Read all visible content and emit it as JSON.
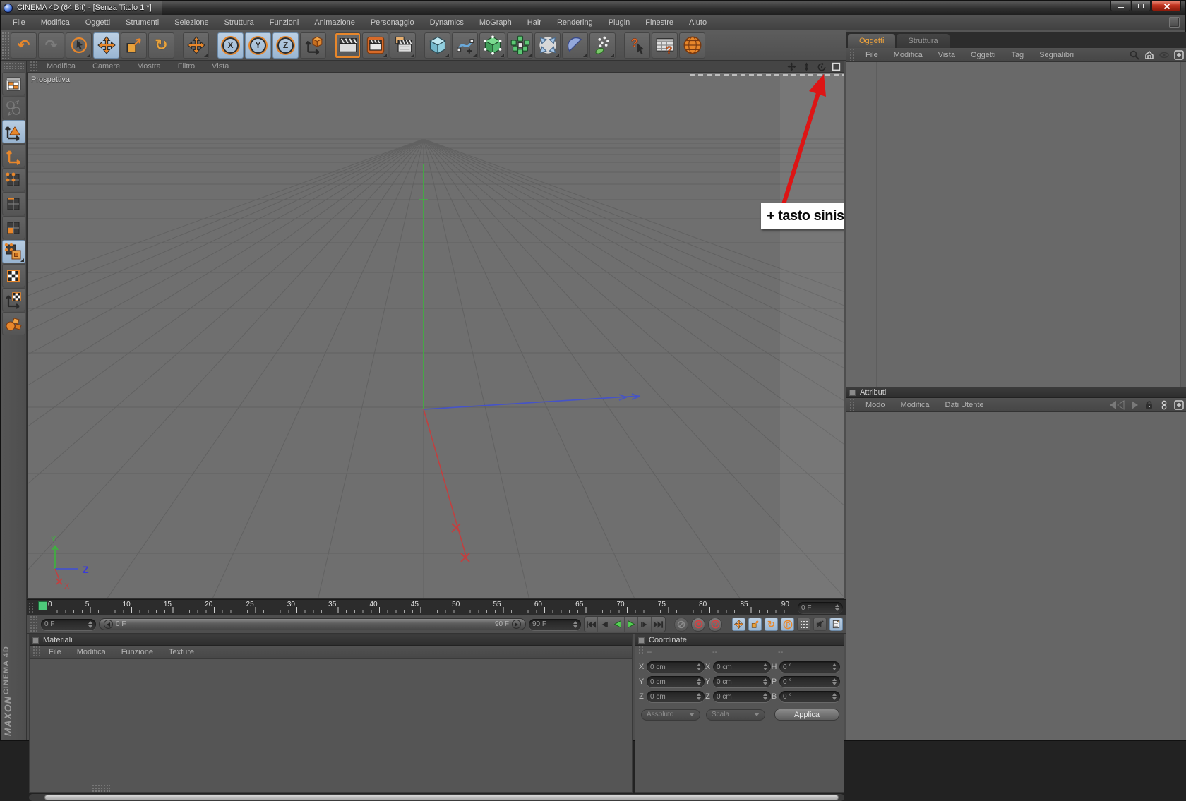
{
  "window": {
    "title": "CINEMA 4D (64 Bit) - [Senza Titolo 1 *]",
    "controls": [
      "minimize",
      "restore",
      "close"
    ]
  },
  "menubar": {
    "items": [
      "File",
      "Modifica",
      "Oggetti",
      "Strumenti",
      "Selezione",
      "Struttura",
      "Funzioni",
      "Animazione",
      "Personaggio",
      "Dynamics",
      "MoGraph",
      "Hair",
      "Rendering",
      "Plugin",
      "Finestre",
      "Aiuto"
    ]
  },
  "toolbar": {
    "icons": [
      "undo",
      "redo",
      "live-selection",
      "move",
      "scale",
      "rotate",
      "last-tool-move",
      "lock-x",
      "lock-y",
      "lock-z",
      "coordinate-system",
      "render-view",
      "render-picture-viewer",
      "render-settings",
      "primitive-cube",
      "spline",
      "subdivision-surface",
      "array-object",
      "deformer",
      "environment",
      "particles",
      "context-help",
      "content-browser",
      "online-updater"
    ],
    "axis_locks": [
      "X",
      "Y",
      "Z"
    ],
    "glyphs": {
      "undo": "↶",
      "redo": "↷",
      "rotate": "↻",
      "help_question": "?",
      "browser_question": "?"
    }
  },
  "sidebar": {
    "icons": [
      "layout",
      "make-editable",
      "model-mode",
      "axis-mode",
      "points-mode",
      "edges-mode",
      "polygons-mode",
      "texture-mode",
      "texture",
      "workplane",
      "snap"
    ]
  },
  "viewport": {
    "menu": [
      "Modifica",
      "Camere",
      "Mostra",
      "Filtro",
      "Vista"
    ],
    "label": "Prospettiva",
    "nav_icons": [
      "pan",
      "dolly",
      "rotate-camera",
      "toggle-panels"
    ],
    "annotation": "+ tasto sinistro",
    "axis_indicator": {
      "x": "X",
      "y": "Y",
      "z": "Z"
    }
  },
  "timeline": {
    "ruler_labels": [
      "0",
      "5",
      "10",
      "15",
      "20",
      "25",
      "30",
      "35",
      "40",
      "45",
      "50",
      "55",
      "60",
      "65",
      "70",
      "75",
      "80",
      "85",
      "90"
    ],
    "frame_spinner": "0 F"
  },
  "playback": {
    "start_field": "0 F",
    "range_start": "0 F",
    "range_end": "90 F",
    "end_field": "90 F",
    "transport": [
      "goto-start",
      "previous-frame",
      "play-backward",
      "play-forward",
      "next-frame",
      "goto-end"
    ],
    "key_buttons": [
      "record-disabled",
      "autokey",
      "key-help"
    ],
    "toggles": [
      "key-position",
      "key-scale",
      "key-rotation",
      "key-parameter",
      "key-pla",
      "sound-off",
      "document"
    ],
    "glyphs": {
      "rotate": "↻",
      "param": "P",
      "question": "?"
    }
  },
  "materials_panel": {
    "title": "Materiali",
    "menu": [
      "File",
      "Modifica",
      "Funzione",
      "Texture"
    ]
  },
  "coordinates_panel": {
    "title": "Coordinate",
    "column_headers": [
      "--",
      "--",
      "--"
    ],
    "position_rows": [
      {
        "label": "X",
        "value": "0 cm"
      },
      {
        "label": "Y",
        "value": "0 cm"
      },
      {
        "label": "Z",
        "value": "0 cm"
      }
    ],
    "scale_rows": [
      {
        "label": "X",
        "value": "0 cm"
      },
      {
        "label": "Y",
        "value": "0 cm"
      },
      {
        "label": "Z",
        "value": "0 cm"
      }
    ],
    "rotation_rows": [
      {
        "label": "H",
        "value": "0 °"
      },
      {
        "label": "P",
        "value": "0 °"
      },
      {
        "label": "B",
        "value": "0 °"
      }
    ],
    "mode_dropdown": "Assoluto",
    "size_dropdown": "Scala",
    "apply_button": "Applica"
  },
  "object_manager": {
    "tabs": [
      {
        "label": "Oggetti",
        "active": true
      },
      {
        "label": "Struttura",
        "active": false
      }
    ],
    "menu": [
      "File",
      "Modifica",
      "Vista",
      "Oggetti",
      "Tag",
      "Segnalibri"
    ],
    "icons": [
      "search",
      "home",
      "eye",
      "add"
    ]
  },
  "attributes_panel": {
    "title": "Attributi",
    "menu": [
      "Modo",
      "Modifica",
      "Dati Utente"
    ],
    "icons": [
      "nav-back",
      "nav-forward",
      "lock",
      "track",
      "add"
    ]
  },
  "branding": {
    "line1": "MAXON",
    "line2": "CINEMA 4D"
  },
  "colors": {
    "accent_orange": "#e8872b",
    "highlight_blue": "#a8c2dc",
    "arrow_red": "#dd1515",
    "axis_green": "#3db53d",
    "axis_blue": "#4553c8",
    "axis_red": "#c04040",
    "tab_active_text": "#f0a43c",
    "viewport_bg": "#6f6f6f"
  }
}
